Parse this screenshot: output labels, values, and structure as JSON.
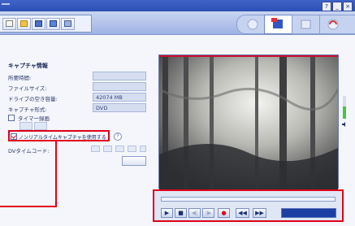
{
  "window": {
    "buttons": [
      "?",
      "_",
      "×"
    ]
  },
  "capture_info": {
    "title": "キャプチャ情報",
    "rows": [
      {
        "label": "所要時間:",
        "value": ""
      },
      {
        "label": "ファイルサイズ:",
        "value": ""
      },
      {
        "label": "ドライブの空き容量:",
        "value": "42074 MB"
      },
      {
        "label": "キャプチャ形式:",
        "value": "DVD"
      }
    ],
    "timer_label": "タイマー録画",
    "timer_checked": false,
    "realtime_label": "ノンリアルタイムキャプチャを使用する",
    "realtime_checked": true,
    "help_glyph": "?",
    "dv_timecode_label": "DVタイムコード:"
  },
  "controls": {
    "play": "▶",
    "stop": "■",
    "prev": "◀|",
    "next": "|▶",
    "record": "●",
    "rewind": "◀◀",
    "forward": "▶▶"
  },
  "meter": {
    "level": 0.55
  },
  "colors": {
    "accent": "#e0001b",
    "titlebar": "#2c4fb4",
    "display": "#1c3fa4"
  }
}
